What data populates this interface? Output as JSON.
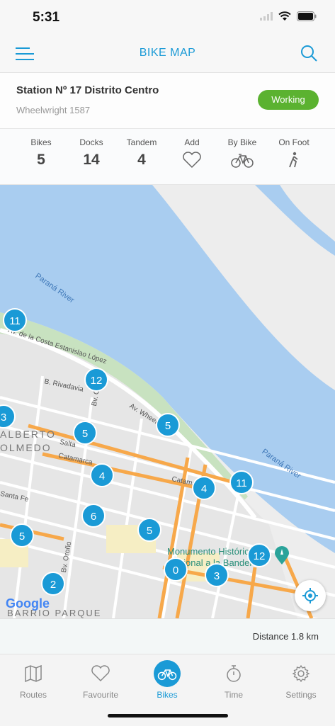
{
  "status_bar": {
    "time": "5:31"
  },
  "nav": {
    "title": "BIKE MAP"
  },
  "station": {
    "name": "Station Nº 17 Distrito Centro",
    "address": "Wheelwright 1587",
    "status": "Working",
    "status_color": "#5bb230"
  },
  "stats": {
    "bikes": {
      "label": "Bikes",
      "value": "5"
    },
    "docks": {
      "label": "Docks",
      "value": "14"
    },
    "tandem": {
      "label": "Tandem",
      "value": "4"
    },
    "add": {
      "label": "Add",
      "icon": "heart-icon"
    },
    "by_bike": {
      "label": "By Bike",
      "icon": "bike-icon"
    },
    "on_foot": {
      "label": "On Foot",
      "icon": "walk-icon"
    }
  },
  "map": {
    "clusters": [
      "11",
      "12",
      "3",
      "5",
      "5",
      "4",
      "4",
      "11",
      "6",
      "5",
      "5",
      "0",
      "3",
      "12",
      "2"
    ],
    "labels": {
      "river1": "Paraná River",
      "river2": "Paraná River",
      "street1": "Av. de la Costa Estanislao López",
      "street2": "B. Rivadavia",
      "street3": "Av. Wheelwright",
      "street4": "Salta",
      "street5": "Catamarca",
      "street6": "Catamarca",
      "street7": "Santa Fe",
      "street8": "Bv. Oroño",
      "street9": "Bv. Oroño",
      "district1": "ALBERTO",
      "district2": "OLMEDO",
      "monument": "Monumento Histórico Nacional a la Bandera",
      "barrio": "BARRIO PARQUE"
    },
    "google": "Google"
  },
  "distance": {
    "text": "Distance 1.8 km"
  },
  "tabs": [
    {
      "label": "Routes",
      "icon": "map-icon"
    },
    {
      "label": "Favourite",
      "icon": "heart-icon"
    },
    {
      "label": "Bikes",
      "icon": "bike-icon",
      "active": true
    },
    {
      "label": "Time",
      "icon": "stopwatch-icon"
    },
    {
      "label": "Settings",
      "icon": "gear-icon"
    }
  ],
  "colors": {
    "accent": "#1a9ad6",
    "working": "#5bb230",
    "road": "#f7a84a",
    "water": "#a9cdf0"
  }
}
